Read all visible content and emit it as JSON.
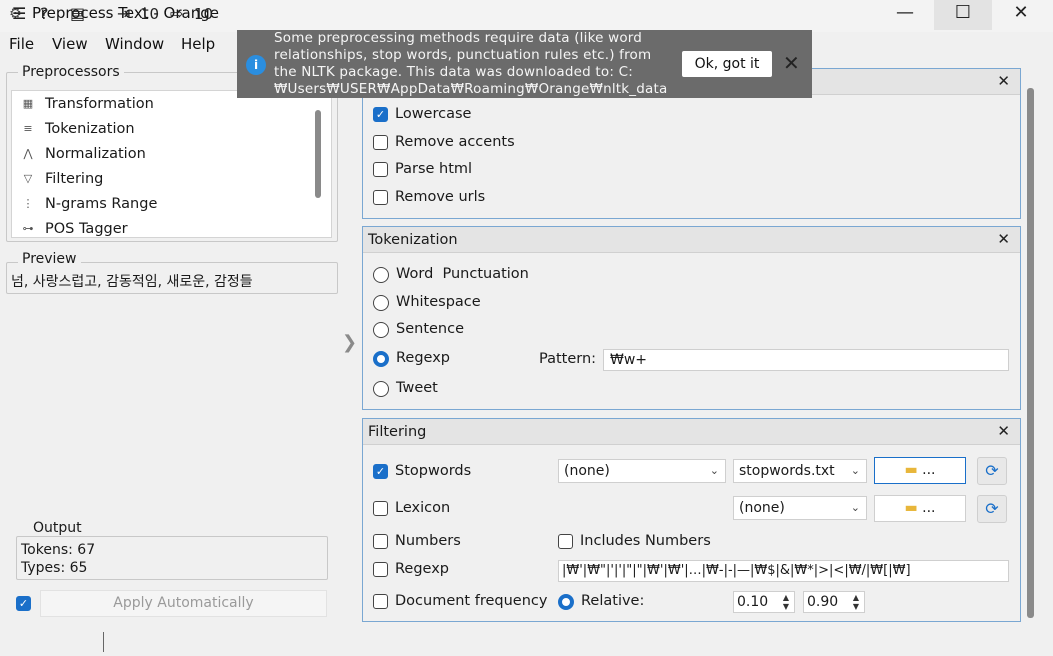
{
  "window": {
    "title": "Preprocess Text - Orange"
  },
  "menu": {
    "items": [
      "File",
      "View",
      "Window",
      "Help"
    ]
  },
  "notification": {
    "lines": [
      "Some preprocessing methods require data (like word",
      "relationships, stop words, punctuation rules etc.) from",
      "the NLTK package. This data was downloaded to: C:",
      "₩Users₩USER₩AppData₩Roaming₩Orange₩nltk_data"
    ],
    "ok_label": "Ok, got it"
  },
  "preprocessors": {
    "title": "Preprocessors",
    "items": [
      {
        "label": "Transformation",
        "icon": "transformation-icon"
      },
      {
        "label": "Tokenization",
        "icon": "tokenization-icon"
      },
      {
        "label": "Normalization",
        "icon": "normalization-icon"
      },
      {
        "label": "Filtering",
        "icon": "filter-icon"
      },
      {
        "label": "N-grams Range",
        "icon": "ngrams-icon"
      },
      {
        "label": "POS Tagger",
        "icon": "pos-tagger-icon"
      }
    ]
  },
  "preview": {
    "title": "Preview",
    "text": "넘, 사랑스럽고, 감동적임, 새로운, 감정들"
  },
  "output": {
    "title": "Output",
    "tokens": "Tokens: 67",
    "types": "Types: 65"
  },
  "apply": {
    "label": "Apply Automatically",
    "checked": true
  },
  "status": {
    "input_count": "10",
    "output_count": "10"
  },
  "transformation": {
    "options": [
      {
        "label": "Lowercase",
        "checked": true
      },
      {
        "label": "Remove accents",
        "checked": false
      },
      {
        "label": "Parse html",
        "checked": false
      },
      {
        "label": "Remove urls",
        "checked": false
      }
    ]
  },
  "tokenization": {
    "title": "Tokenization",
    "options": [
      {
        "label": "Word  Punctuation",
        "selected": false
      },
      {
        "label": "Whitespace",
        "selected": false
      },
      {
        "label": "Sentence",
        "selected": false
      },
      {
        "label": "Regexp",
        "selected": true
      },
      {
        "label": "Tweet",
        "selected": false
      }
    ],
    "pattern_label": "Pattern:",
    "pattern_value": "₩w+"
  },
  "filtering": {
    "title": "Filtering",
    "stopwords": {
      "label": "Stopwords",
      "checked": true,
      "language": "(none)",
      "file": "stopwords.txt",
      "button": "..."
    },
    "lexicon": {
      "label": "Lexicon",
      "checked": false,
      "file": "(none)",
      "button": "..."
    },
    "numbers": {
      "label": "Numbers",
      "checked": false
    },
    "includes_numbers": {
      "label": "Includes Numbers",
      "checked": false
    },
    "regexp": {
      "label": "Regexp",
      "checked": false,
      "value": "|₩'|₩\"|'|'|\"|\"|₩'|₩'|…|₩-|-|—|₩$|&|₩*|>|<|₩/|₩[|₩]"
    },
    "doc_freq": {
      "label": "Document frequency",
      "checked": false
    },
    "relative": {
      "label": "Relative:",
      "selected": true,
      "min": "0.10",
      "max": "0.90"
    }
  },
  "colors": {
    "accent": "#1a6fc9",
    "panel_border": "#7aa7d2",
    "notification_bg": "#6b6b6b"
  }
}
